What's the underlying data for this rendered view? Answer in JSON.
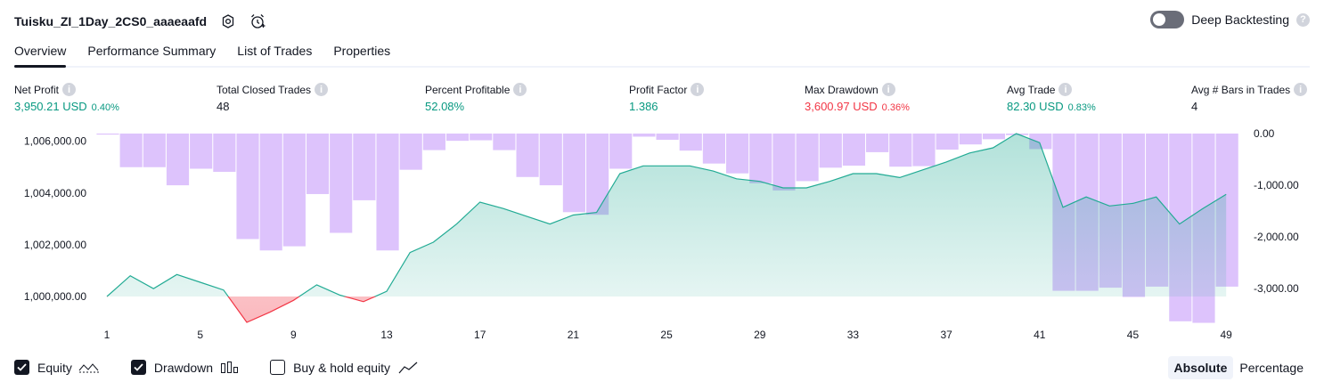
{
  "header": {
    "strategy_name": "Tuisku_ZI_1Day_2CS0_aaaeaafd",
    "deep_backtesting_label": "Deep Backtesting"
  },
  "tabs": [
    {
      "label": "Overview"
    },
    {
      "label": "Performance Summary"
    },
    {
      "label": "List of Trades"
    },
    {
      "label": "Properties"
    }
  ],
  "metrics": {
    "net_profit": {
      "label": "Net Profit",
      "value": "3,950.21 USD",
      "pct": "0.40%"
    },
    "total_closed_trades": {
      "label": "Total Closed Trades",
      "value": "48"
    },
    "percent_profitable": {
      "label": "Percent Profitable",
      "value": "52.08%"
    },
    "profit_factor": {
      "label": "Profit Factor",
      "value": "1.386"
    },
    "max_drawdown": {
      "label": "Max Drawdown",
      "value": "3,600.97 USD",
      "pct": "0.36%"
    },
    "avg_trade": {
      "label": "Avg Trade",
      "value": "82.30 USD",
      "pct": "0.83%"
    },
    "avg_bars": {
      "label": "Avg # Bars in Trades",
      "value": "4"
    }
  },
  "legend": {
    "equity": "Equity",
    "drawdown": "Drawdown",
    "buy_hold": "Buy & hold equity"
  },
  "view_switch": {
    "absolute": "Absolute",
    "percentage": "Percentage"
  },
  "colors": {
    "equity_line": "#22ab94",
    "equity_negative": "#f23645",
    "drawdown_bar": "#d7b8fb",
    "positive": "#089981",
    "negative": "#f23645"
  },
  "chart_data": {
    "type": "area",
    "x_ticks": [
      "1",
      "5",
      "9",
      "13",
      "17",
      "21",
      "25",
      "29",
      "33",
      "37",
      "41",
      "45",
      "49"
    ],
    "left_axis": {
      "ticks": [
        "1,006,000.00",
        "1,004,000.00",
        "1,002,000.00",
        "1,000,000.00"
      ],
      "ylim": [
        999000,
        1006300
      ]
    },
    "right_axis": {
      "ticks": [
        "0.00",
        "-1,000.00",
        "-2,000.00",
        "-3,000.00"
      ],
      "ylim": [
        -3650,
        0
      ]
    },
    "equity": {
      "name": "Equity",
      "x": [
        1,
        2,
        3,
        4,
        5,
        6,
        7,
        8,
        9,
        10,
        11,
        12,
        13,
        14,
        15,
        16,
        17,
        18,
        19,
        20,
        21,
        22,
        23,
        24,
        25,
        26,
        27,
        28,
        29,
        30,
        31,
        32,
        33,
        34,
        35,
        36,
        37,
        38,
        39,
        40,
        41,
        42,
        43,
        44,
        45,
        46,
        47,
        48,
        49
      ],
      "values": [
        1000000,
        1000800,
        1000300,
        1000850,
        1000550,
        1000250,
        999000,
        999400,
        999850,
        1000450,
        1000050,
        999800,
        1000200,
        1001700,
        1002100,
        1002800,
        1003650,
        1003400,
        1003100,
        1002800,
        1003150,
        1003250,
        1004750,
        1005050,
        1005050,
        1005050,
        1004850,
        1004550,
        1004450,
        1004200,
        1004200,
        1004450,
        1004750,
        1004750,
        1004600,
        1004900,
        1005200,
        1005550,
        1005750,
        1006300,
        1005950,
        1003450,
        1003850,
        1003500,
        1003600,
        1003850,
        1002800,
        1003400,
        1003950
      ]
    },
    "drawdown": {
      "name": "Drawdown",
      "x": [
        1,
        2,
        3,
        4,
        5,
        6,
        7,
        8,
        9,
        10,
        11,
        12,
        13,
        14,
        15,
        16,
        17,
        18,
        19,
        20,
        21,
        22,
        23,
        24,
        25,
        26,
        27,
        28,
        29,
        30,
        31,
        32,
        33,
        34,
        35,
        36,
        37,
        38,
        39,
        40,
        41,
        42,
        43,
        44,
        45,
        46,
        47,
        48,
        49
      ],
      "values": [
        -20,
        -650,
        -650,
        -1000,
        -680,
        -740,
        -2040,
        -2260,
        -2180,
        -1170,
        -1920,
        -1290,
        -2260,
        -700,
        -320,
        -140,
        -130,
        -320,
        -840,
        -1000,
        -1520,
        -1570,
        -680,
        -60,
        -120,
        -330,
        -580,
        -770,
        -960,
        -1100,
        -920,
        -660,
        -620,
        -360,
        -640,
        -630,
        -310,
        -210,
        -110,
        -30,
        -300,
        -3040,
        -3040,
        -2980,
        -3160,
        -2960,
        -3630,
        -3660,
        -2960
      ]
    }
  }
}
